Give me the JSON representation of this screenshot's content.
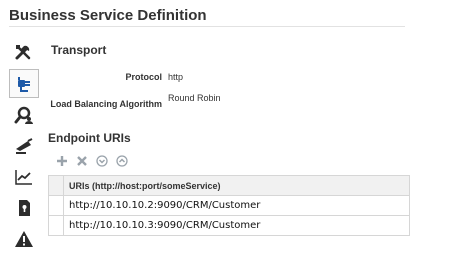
{
  "page": {
    "title": "Business Service Definition"
  },
  "side_toolbar": {
    "items": [
      {
        "icon": "wrench-screwdriver-icon",
        "active": false
      },
      {
        "icon": "transport-plug-icon",
        "active": true
      },
      {
        "icon": "search-person-icon",
        "active": false
      },
      {
        "icon": "message-handling-icon",
        "active": false
      },
      {
        "icon": "line-chart-icon",
        "active": false
      },
      {
        "icon": "security-lock-icon",
        "active": false
      },
      {
        "icon": "warning-icon",
        "active": false
      }
    ]
  },
  "transport": {
    "heading": "Transport",
    "protocol_label": "Protocol",
    "protocol_value": "http",
    "lb_label": "Load Balancing Algorithm",
    "lb_value": "Round Robin"
  },
  "endpoints": {
    "heading": "Endpoint URIs",
    "toolbar": [
      "add-icon",
      "delete-icon",
      "move-down-icon",
      "move-up-icon"
    ],
    "column_header": "URIs (http://host:port/someService)",
    "rows": [
      "http://10.10.10.2:9090/CRM/Customer",
      "http://10.10.10.3:9090/CRM/Customer"
    ]
  },
  "colors": {
    "icon_dark": "#2d2d2d",
    "icon_blue": "#1e5aa8",
    "toolbar_grey": "#9aa3ab"
  }
}
